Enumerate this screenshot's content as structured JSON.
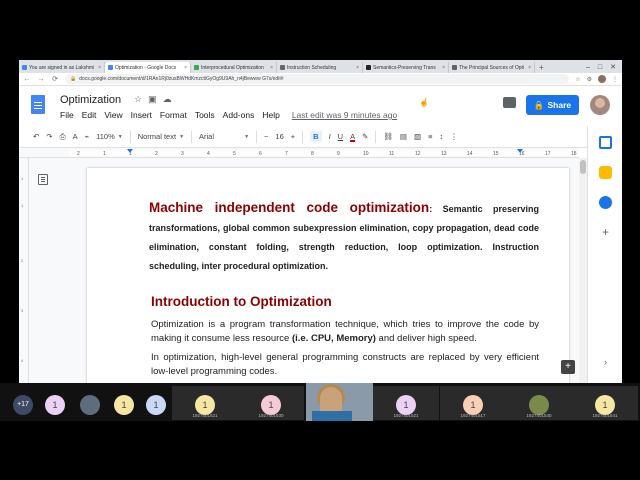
{
  "browser": {
    "tabs": [
      {
        "title": "You are signed in as Lakshmi",
        "color": "#4285f4"
      },
      {
        "title": "Optimization - Google Docs",
        "color": "#4285f4",
        "active": true
      },
      {
        "title": "Interprocedural Optimization",
        "color": "#34a853"
      },
      {
        "title": "Instruction Scheduling",
        "color": "#666666"
      },
      {
        "title": "Semantics-Preserving Trans",
        "color": "#222222"
      },
      {
        "title": "The Principal Sources of Opti",
        "color": "#5f6368"
      }
    ],
    "new_tab": "+",
    "url": "docs.google.com/document/d/1RAn1Rj0zusBWHdKmzctiGyOg9U9Ah_n4jBewww G7s/edit#"
  },
  "docs": {
    "title": "Optimization",
    "menu": [
      "File",
      "Edit",
      "View",
      "Insert",
      "Format",
      "Tools",
      "Add-ons",
      "Help"
    ],
    "last_edit": "Last edit was 9 minutes ago",
    "share_label": "Share"
  },
  "toolbar": {
    "zoom": "110%",
    "style": "Normal text",
    "font": "Arial",
    "size": "16",
    "bold": "B",
    "italic": "I",
    "underline": "U",
    "text_color": "A"
  },
  "ruler": {
    "ticks": [
      "2",
      "1",
      "1",
      "2",
      "3",
      "4",
      "5",
      "6",
      "7",
      "8",
      "9",
      "10",
      "11",
      "12",
      "13",
      "14",
      "15",
      "16",
      "17",
      "18"
    ]
  },
  "document": {
    "heading1": "Machine independent code optimization",
    "heading1_rest": ": Semantic preserving transformations, global common subexpression elimination, copy propagation, dead code elimination, constant folding, strength reduction, loop optimization. Instruction scheduling, inter procedural optimization.",
    "heading2": "Introduction to Optimization",
    "para1_a": "Optimization is a program transformation technique, which tries to improve the code by making it consume less resource ",
    "para1_b": "(i.e. CPU, Memory)",
    "para1_c": " and deliver high speed.",
    "para2": "In optimization, high-level general programming constructs are replaced by very efficient low-level programming codes."
  },
  "meeting": {
    "participants": [
      {
        "label": "+17",
        "kind": "cnt"
      },
      {
        "label": "1",
        "kind": "lav"
      },
      {
        "label": "",
        "kind": "photo"
      },
      {
        "label": "1",
        "kind": "yel"
      },
      {
        "label": "1",
        "kind": "blue"
      },
      {
        "label": "1",
        "kind": "yel",
        "name": "1927401521"
      },
      {
        "label": "1",
        "kind": "pink",
        "name": "1927401530"
      },
      {
        "label": "1",
        "kind": "lav",
        "name": "1927401521"
      },
      {
        "label": "1",
        "kind": "peach",
        "name": "1927401517"
      },
      {
        "label": "",
        "kind": "green",
        "name": "1927401540"
      },
      {
        "label": "1",
        "kind": "yel",
        "name": "1927401541"
      }
    ]
  }
}
